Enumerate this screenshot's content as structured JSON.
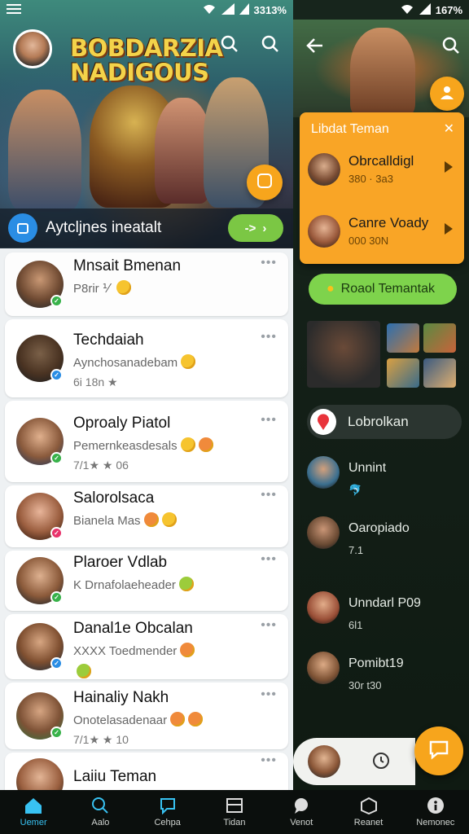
{
  "status": {
    "left": {
      "time": ""
    },
    "right_text": "3313%",
    "right2_text": "167%"
  },
  "banner": {
    "game_title": "BOBDARZIA NADIGOUS",
    "post_prompt": "Aytcljnes ineatalt",
    "green_pill": "->"
  },
  "chats": [
    {
      "name": "Mnsait Bmenan",
      "sub": "P8rir ⅟ ",
      "meta": "",
      "badge": "green"
    },
    {
      "name": "Techdaiah",
      "sub": "Aynchosanadebam",
      "meta": "6i 18n ★",
      "badge": "blue"
    },
    {
      "name": "Oproaly Piatol",
      "sub": "Pemernkeasdesals",
      "meta": "7/1★ ★ 06",
      "badge": "green"
    },
    {
      "name": "Salorolsaca",
      "sub": "Bianela Mas",
      "meta": "",
      "badge": "pink"
    },
    {
      "name": "Plaroer Vdlab",
      "sub": "K Drnafolaeheader",
      "meta": "",
      "badge": "green"
    },
    {
      "name": "Danal1e Obcalan",
      "sub": "XXXX Toedmender",
      "meta": "",
      "badge": "blue"
    },
    {
      "name": "Hainaliy Nakh",
      "sub": "Onotelasadenaar",
      "meta": "7/1★ ★ 10",
      "badge": "green"
    },
    {
      "name": "Laiiu Teman",
      "sub": "",
      "meta": "",
      "badge": "red"
    }
  ],
  "right": {
    "card_title": "Libdat Teman",
    "card_items": [
      {
        "name": "Obrcalldigl",
        "sub": "380 · 3a3"
      },
      {
        "name": "Canre Voady",
        "sub": "000 30N"
      }
    ],
    "green_button": "Roaol Temantak",
    "chip_label": "Lobrolkan",
    "items": [
      {
        "name": "Unnint",
        "sub": "🐬"
      },
      {
        "name": "Oaropiado",
        "sub": "7.1"
      },
      {
        "name": "Unndarl P09",
        "sub": "6l1"
      },
      {
        "name": "Pomibt19",
        "sub": "30r t30"
      }
    ]
  },
  "nav": [
    {
      "label": "Uemer",
      "icon": "home-icon",
      "active": true
    },
    {
      "label": "Aalo",
      "icon": "search-icon",
      "active": false
    },
    {
      "label": "Cehpa",
      "icon": "chat-icon",
      "active": false
    },
    {
      "label": "Tidan",
      "icon": "tablet-icon",
      "active": false
    },
    {
      "label": "Venot",
      "icon": "bubble-icon",
      "active": false
    },
    {
      "label": "Reanet",
      "icon": "box-icon",
      "active": false
    },
    {
      "label": "Nemonec",
      "icon": "more-icon",
      "active": false
    }
  ],
  "colors": {
    "accent": "#f7a51c",
    "green": "#7bc744",
    "blue": "#2a8de4",
    "active_tab": "#38c2f2"
  }
}
